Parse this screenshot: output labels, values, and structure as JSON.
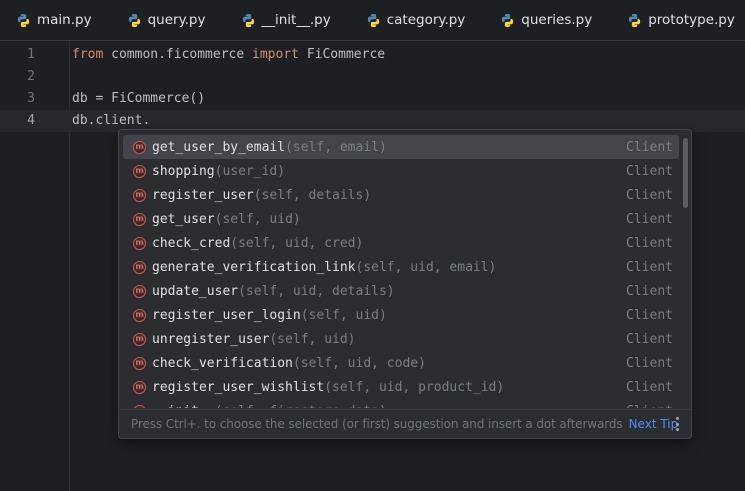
{
  "tabs": [
    {
      "label": "main.py",
      "icon": "python-icon"
    },
    {
      "label": "query.py",
      "icon": "python-icon"
    },
    {
      "label": "__init__.py",
      "icon": "python-icon"
    },
    {
      "label": "category.py",
      "icon": "python-icon"
    },
    {
      "label": "queries.py",
      "icon": "python-icon"
    },
    {
      "label": "prototype.py",
      "icon": "python-icon"
    }
  ],
  "editor": {
    "current_line": 4,
    "lines": [
      {
        "num": "1",
        "kw1": "from",
        "mid": " common.ficommerce ",
        "kw2": "import",
        "rest": " FiCommerce"
      },
      {
        "num": "2",
        "text": ""
      },
      {
        "num": "3",
        "text": "db = FiCommerce()"
      },
      {
        "num": "4",
        "text": "db.client."
      }
    ]
  },
  "completion": {
    "selected_index": 0,
    "items": [
      {
        "name": "get_user_by_email",
        "params": "(self, email)",
        "type": "Client"
      },
      {
        "name": "shopping",
        "params": "(user_id)",
        "type": "Client"
      },
      {
        "name": "register_user",
        "params": "(self, details)",
        "type": "Client"
      },
      {
        "name": "get_user",
        "params": "(self, uid)",
        "type": "Client"
      },
      {
        "name": "check_cred",
        "params": "(self, uid, cred)",
        "type": "Client"
      },
      {
        "name": "generate_verification_link",
        "params": "(self, uid, email)",
        "type": "Client"
      },
      {
        "name": "update_user",
        "params": "(self, uid, details)",
        "type": "Client"
      },
      {
        "name": "register_user_login",
        "params": "(self, uid)",
        "type": "Client"
      },
      {
        "name": "unregister_user",
        "params": "(self, uid)",
        "type": "Client"
      },
      {
        "name": "check_verification",
        "params": "(self, uid, code)",
        "type": "Client"
      },
      {
        "name": "register_user_wishlist",
        "params": "(self, uid, product_id)",
        "type": "Client"
      },
      {
        "name": "__init__",
        "params": "(self, firestore_data)",
        "type": "Client"
      }
    ],
    "item_icon": "method-icon",
    "item_icon_letter": "m",
    "footer_hint": "Press Ctrl+. to choose the selected (or first) suggestion and insert a dot afterwards",
    "next_tip": "Next Tip"
  },
  "colors": {
    "background": "#1e1f22",
    "keyword": "#cf8e6d",
    "link": "#548af7",
    "method_icon": "#d9534f"
  }
}
